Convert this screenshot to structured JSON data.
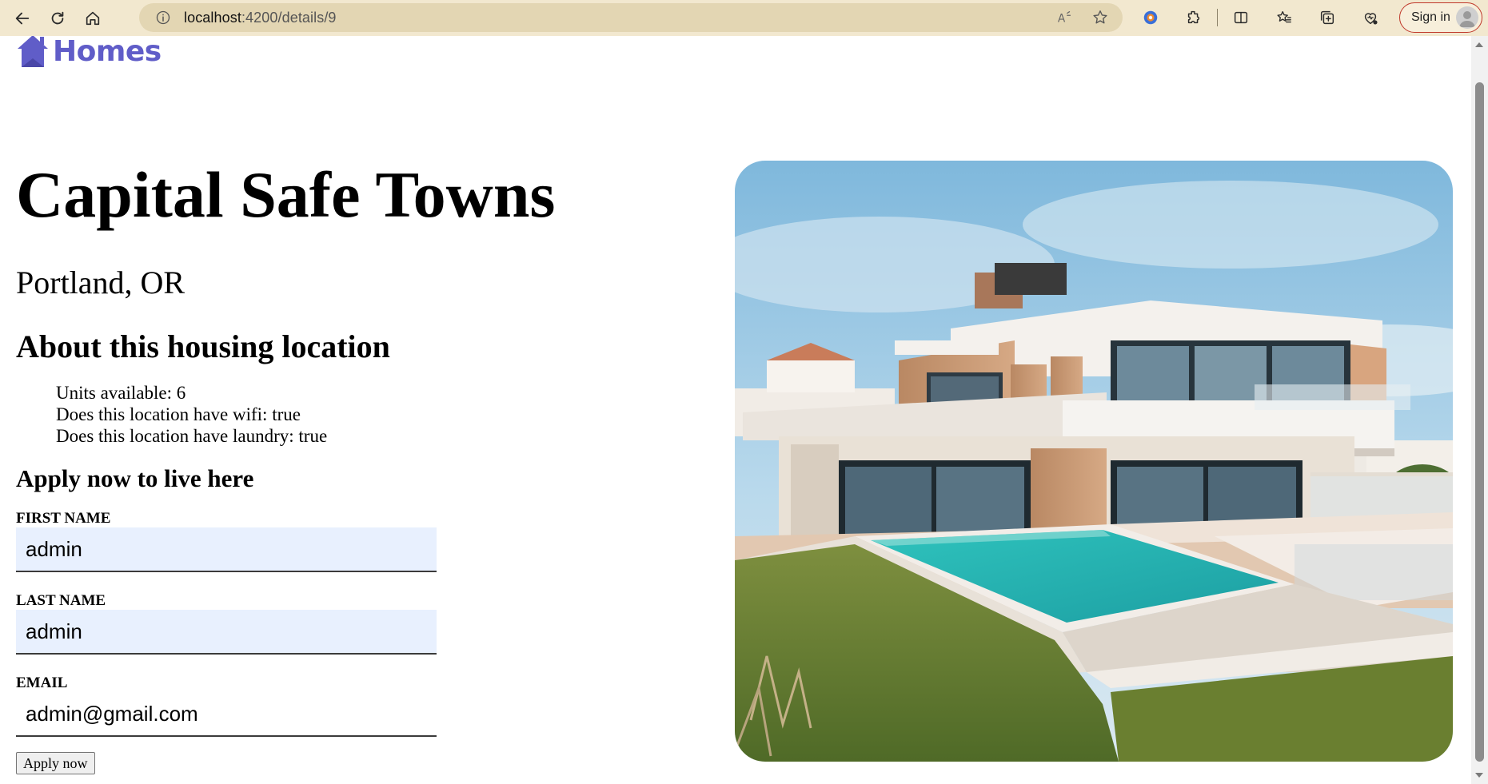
{
  "browser": {
    "url_host": "localhost",
    "url_path": ":4200/details/9",
    "sign_in_label": "Sign in",
    "address_bar_color": "#e3d6b3",
    "chrome_color": "#f2e8cf"
  },
  "header": {
    "logo_text": "Homes",
    "brand_color": "#605dc8"
  },
  "listing": {
    "name": "Capital Safe Towns",
    "location": "Portland, OR",
    "about_heading": "About this housing location",
    "features": [
      "Units available: 6",
      "Does this location have wifi: true",
      "Does this location have laundry: true"
    ]
  },
  "apply_form": {
    "heading": "Apply now to live here",
    "first_name": {
      "label": "First Name",
      "value": "admin"
    },
    "last_name": {
      "label": "Last Name",
      "value": "admin"
    },
    "email": {
      "label": "Email",
      "value": "admin@gmail.com"
    },
    "submit_label": "Apply now"
  },
  "photo": {
    "icon": "modern-villa-with-pool-photo"
  }
}
